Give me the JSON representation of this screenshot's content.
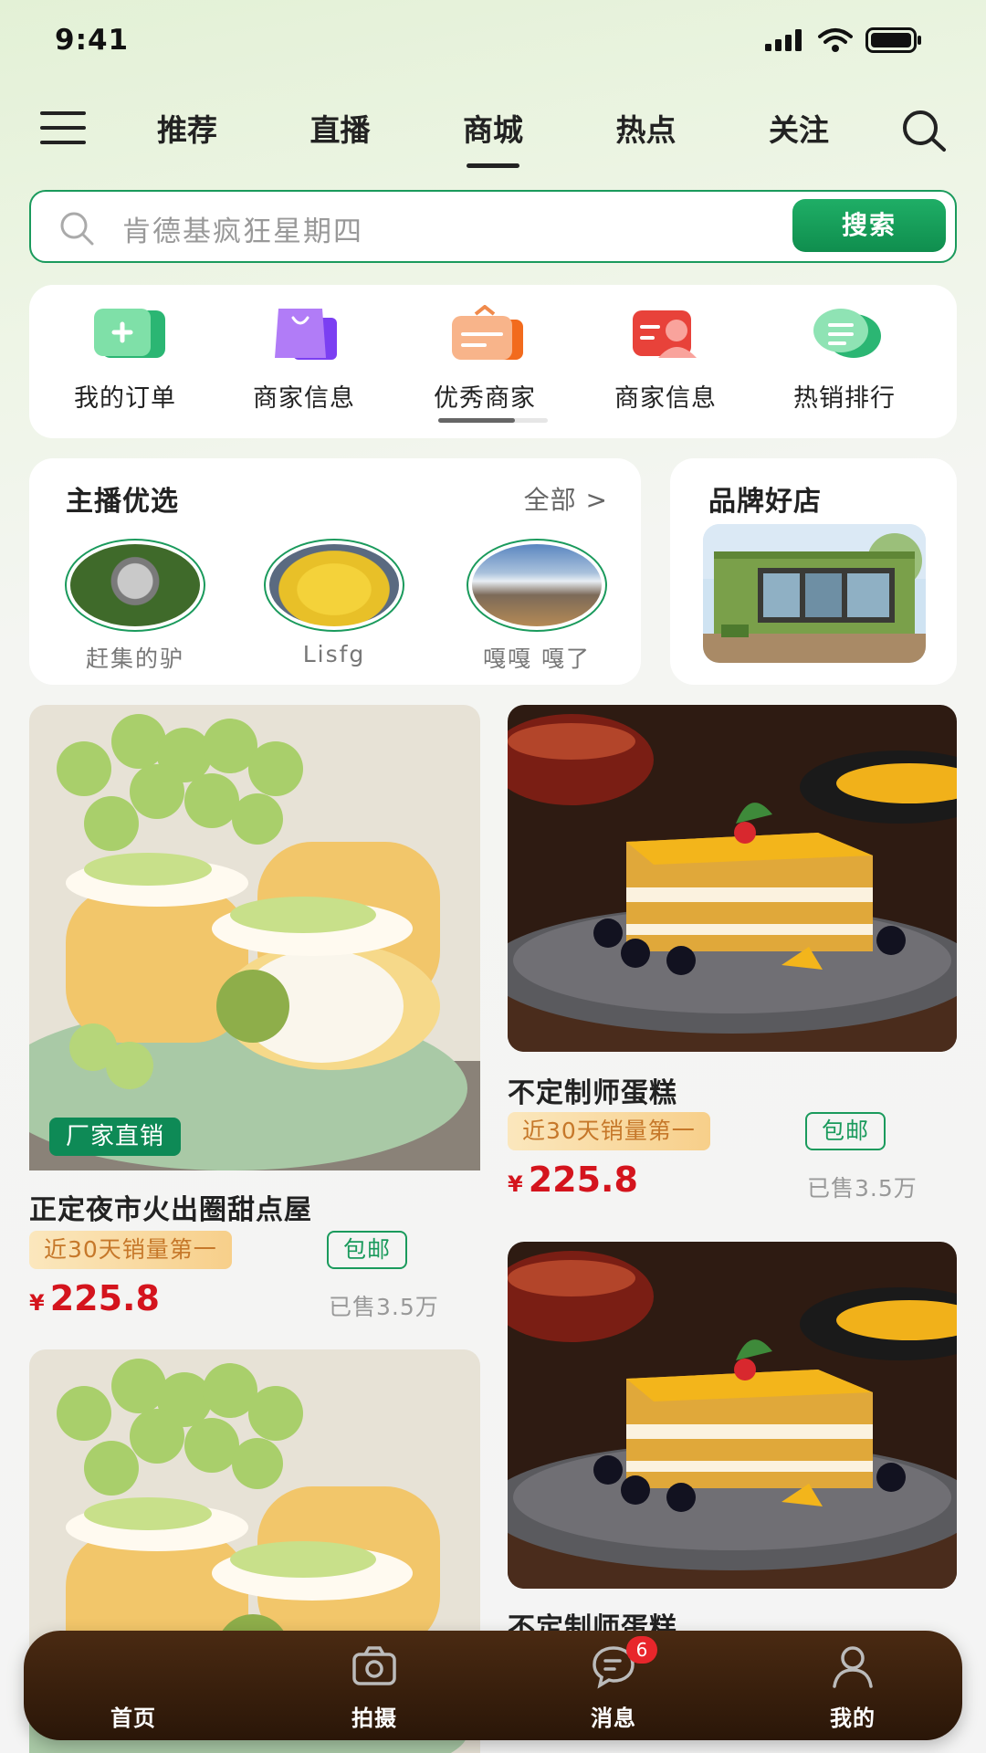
{
  "status_bar": {
    "time": "9:41"
  },
  "nav": {
    "tabs": [
      {
        "label": "推荐"
      },
      {
        "label": "直播"
      },
      {
        "label": "商城",
        "active": true
      },
      {
        "label": "热点"
      },
      {
        "label": "关注"
      }
    ]
  },
  "search": {
    "placeholder": "肯德基疯狂星期四",
    "button_label": "搜索"
  },
  "quick_entries": [
    {
      "label": "我的订单",
      "icon": "order-icon"
    },
    {
      "label": "商家信息",
      "icon": "shopping-bag-icon"
    },
    {
      "label": "优秀商家",
      "icon": "briefcase-icon"
    },
    {
      "label": "商家信息",
      "icon": "merchant-card-icon"
    },
    {
      "label": "热销排行",
      "icon": "chat-list-icon"
    }
  ],
  "anchor_section": {
    "title": "主播优选",
    "all_label": "全部",
    "anchors": [
      {
        "name": "赶集的驴"
      },
      {
        "name": "Lisfg"
      },
      {
        "name": "嘎嘎 嘎了"
      }
    ]
  },
  "brand_section": {
    "title": "品牌好店"
  },
  "products": [
    {
      "title": "正定夜市火出圈甜点屋",
      "factory_tag": "厂家直销",
      "rank_tag": "近30天销量第一",
      "ship_tag": "包邮",
      "currency": "¥",
      "price": "225.8",
      "sold": "已售3.5万"
    },
    {
      "title": "不定制师蛋糕",
      "rank_tag": "近30天销量第一",
      "ship_tag": "包邮",
      "currency": "¥",
      "price": "225.8",
      "sold": "已售3.5万"
    },
    {
      "title": "不定制师蛋糕"
    }
  ],
  "tabbar": {
    "items": [
      {
        "label": "首页"
      },
      {
        "label": "拍摄",
        "icon": "camera-icon"
      },
      {
        "label": "消息",
        "icon": "message-icon",
        "badge": "6"
      },
      {
        "label": "我的",
        "icon": "user-icon"
      }
    ]
  },
  "colors": {
    "accent_green": "#1a9a5c",
    "price_red": "#d4141d",
    "tabbar_brown": "#3a200c"
  }
}
